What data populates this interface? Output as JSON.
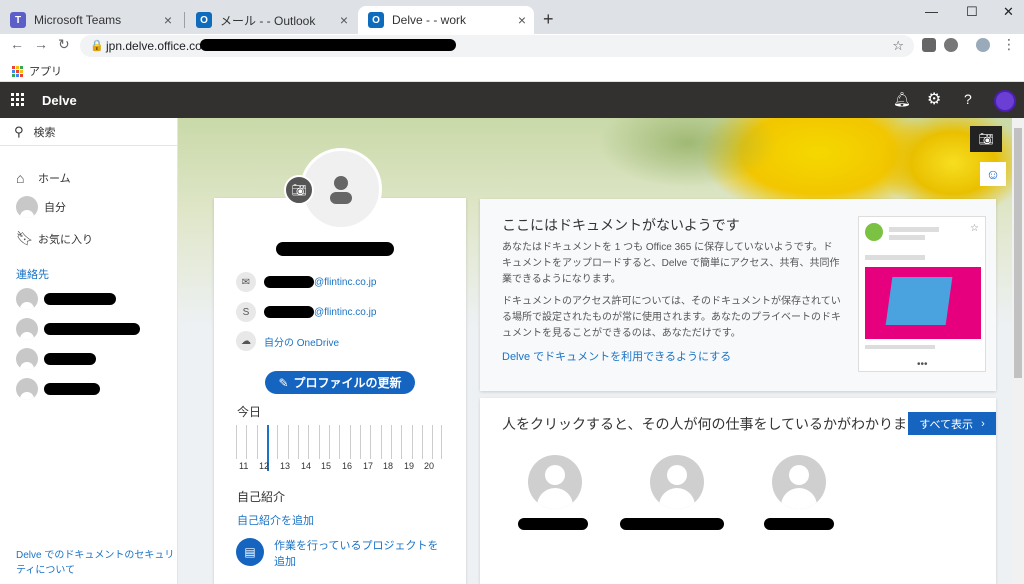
{
  "browser": {
    "tabs": [
      {
        "label": "Microsoft Teams",
        "color": "#5b5fc7",
        "glyph": "T"
      },
      {
        "label": "メール -            - Outlook",
        "color": "#0f6cbd",
        "glyph": "O"
      },
      {
        "label": "Delve -            - work",
        "color": "#0f6cbd",
        "glyph": "O"
      }
    ],
    "url": "jpn.delve.office.com/",
    "bookmark_apps": "アプリ"
  },
  "suite": {
    "app_title": "Delve"
  },
  "leftnav": {
    "search_label": "検索",
    "home_label": "ホーム",
    "me_label": "自分",
    "favorites_label": "お気に入り",
    "contacts_header": "連絡先",
    "security_link": "Delve でのドキュメントのセキュリティについて"
  },
  "profile": {
    "email_domain": "@flintinc.co.jp",
    "skype_domain": "@flintinc.co.jp",
    "onedrive_label": "自分の OneDrive",
    "update_button": "プロファイルの更新",
    "today_label": "今日",
    "calendar_days": [
      "11",
      "12",
      "13",
      "14",
      "15",
      "16",
      "17",
      "18",
      "19",
      "20"
    ],
    "intro_header": "自己紹介",
    "intro_link": "自己紹介を追加",
    "project_link": "作業を行っているプロジェクトを追加"
  },
  "docs_card": {
    "title": "ここにはドキュメントがないようです",
    "para1": "あなたはドキュメントを 1 つも Office 365 に保存していないようです。ドキュメントをアップロードすると、Delve で簡単にアクセス、共有、共同作業できるようになります。",
    "para2": "ドキュメントのアクセス許可については、そのドキュメントが保存されている場所で設定されたものが常に使用されます。あなたのプライベートのドキュメントを見ることができるのは、あなただけです。",
    "link": "Delve でドキュメントを利用できるようにする"
  },
  "people_card": {
    "title": "人をクリックすると、その人が何の仕事をしているかがわかります",
    "show_all": "すべて表示"
  },
  "colors": {
    "accent": "#1565c0",
    "suitebar": "#323130",
    "link": "#1a73c5"
  }
}
